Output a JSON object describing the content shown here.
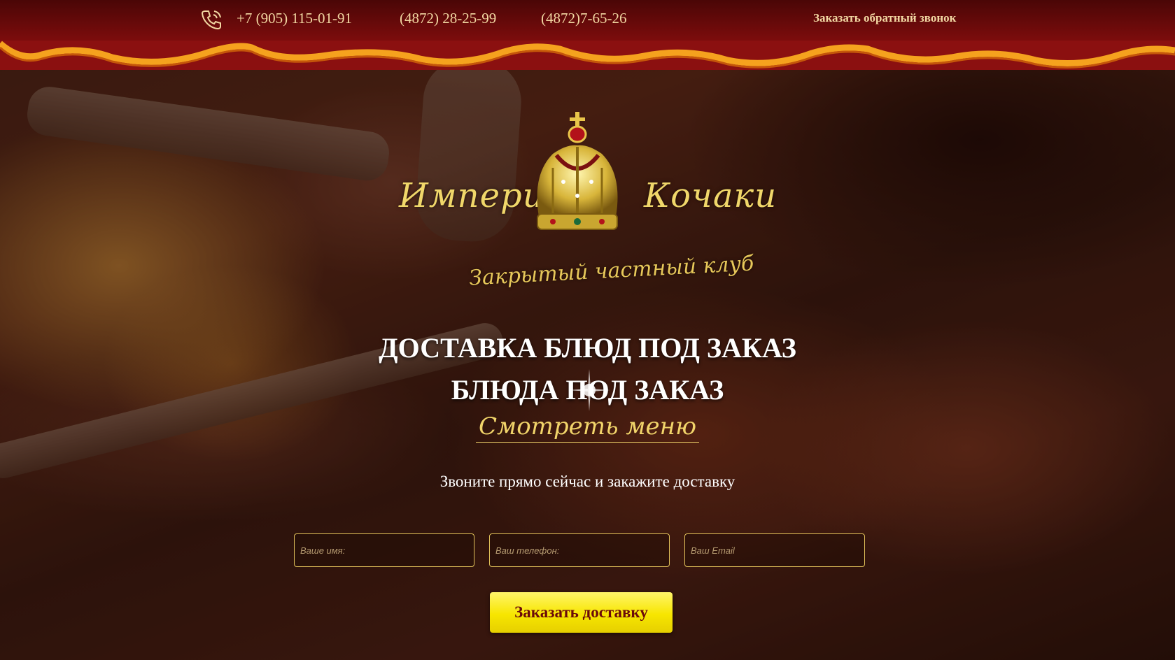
{
  "header": {
    "phones": [
      "+7 (905) 115-01-91",
      "(4872) 28-25-99",
      "(4872)7-65-26"
    ],
    "callback_label": "Заказать обратный звонок"
  },
  "logo": {
    "brand_left": "Империя",
    "brand_right": "Кочаки",
    "tagline": "Закрытый частный клуб"
  },
  "hero": {
    "headline_1": "ДОСТАВКА БЛЮД ПОД ЗАКАЗ",
    "headline_2": "БЛЮДА ПОД ЗАКАЗ",
    "menu_link": "Смотреть меню",
    "callout": "Звоните прямо сейчас и закажите доставку"
  },
  "form": {
    "name_placeholder": "Ваше имя:",
    "phone_placeholder": "Ваш телефон:",
    "email_placeholder": "Ваш Email",
    "submit_label": "Заказать доставку"
  },
  "colors": {
    "header_bg": "#7a0c0c",
    "scallop_orange": "#f5a21e",
    "accent_gold": "#f1d46a",
    "button_yellow": "#f7e600",
    "button_text": "#6b0a0a"
  },
  "icons": [
    "phone-icon",
    "crown-icon",
    "sparkle-icon"
  ]
}
